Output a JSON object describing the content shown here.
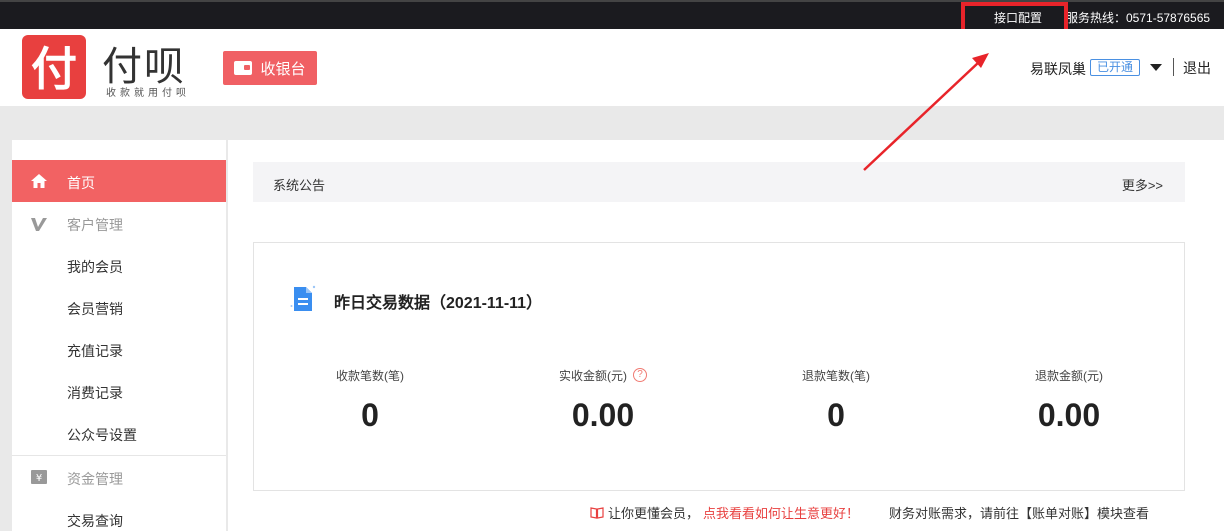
{
  "topbar": {
    "api_config": "接口配置",
    "hotline": "服务热线：0571-57876565"
  },
  "header": {
    "logo_mark": "付",
    "logo_text": "付呗",
    "slogan": "收款就用付呗",
    "cashier_label": "收银台",
    "user_name": "易联凤巢",
    "status": "已开通",
    "logout": "退出"
  },
  "sidebar": {
    "items": [
      {
        "label": "首页",
        "icon": "home-icon",
        "type": "active"
      },
      {
        "label": "客户管理",
        "icon": "v-icon",
        "type": "group"
      },
      {
        "label": "我的会员",
        "type": "sub"
      },
      {
        "label": "会员营销",
        "type": "sub"
      },
      {
        "label": "充值记录",
        "type": "sub"
      },
      {
        "label": "消费记录",
        "type": "sub"
      },
      {
        "label": "公众号设置",
        "type": "sub"
      },
      {
        "label": "资金管理",
        "icon": "yen-icon",
        "type": "group"
      },
      {
        "label": "交易查询",
        "type": "sub"
      }
    ]
  },
  "notice": {
    "title": "系统公告",
    "more": "更多>>"
  },
  "stats": {
    "title": "昨日交易数据（2021-11-11）",
    "items": [
      {
        "label": "收款笔数(笔)",
        "value": "0"
      },
      {
        "label": "实收金额(元)",
        "value": "0.00"
      },
      {
        "label": "退款笔数(笔)",
        "value": "0"
      },
      {
        "label": "退款金额(元)",
        "value": "0.00"
      }
    ]
  },
  "footer": {
    "note": "让你更懂会员，",
    "promo": "点我看看如何让生意更好！",
    "finance": "财务对账需求，请前往【账单对账】模块查看"
  },
  "colors": {
    "brand": "#e8403f",
    "active_menu": "#f26263",
    "link_blue": "#4a90e2"
  }
}
